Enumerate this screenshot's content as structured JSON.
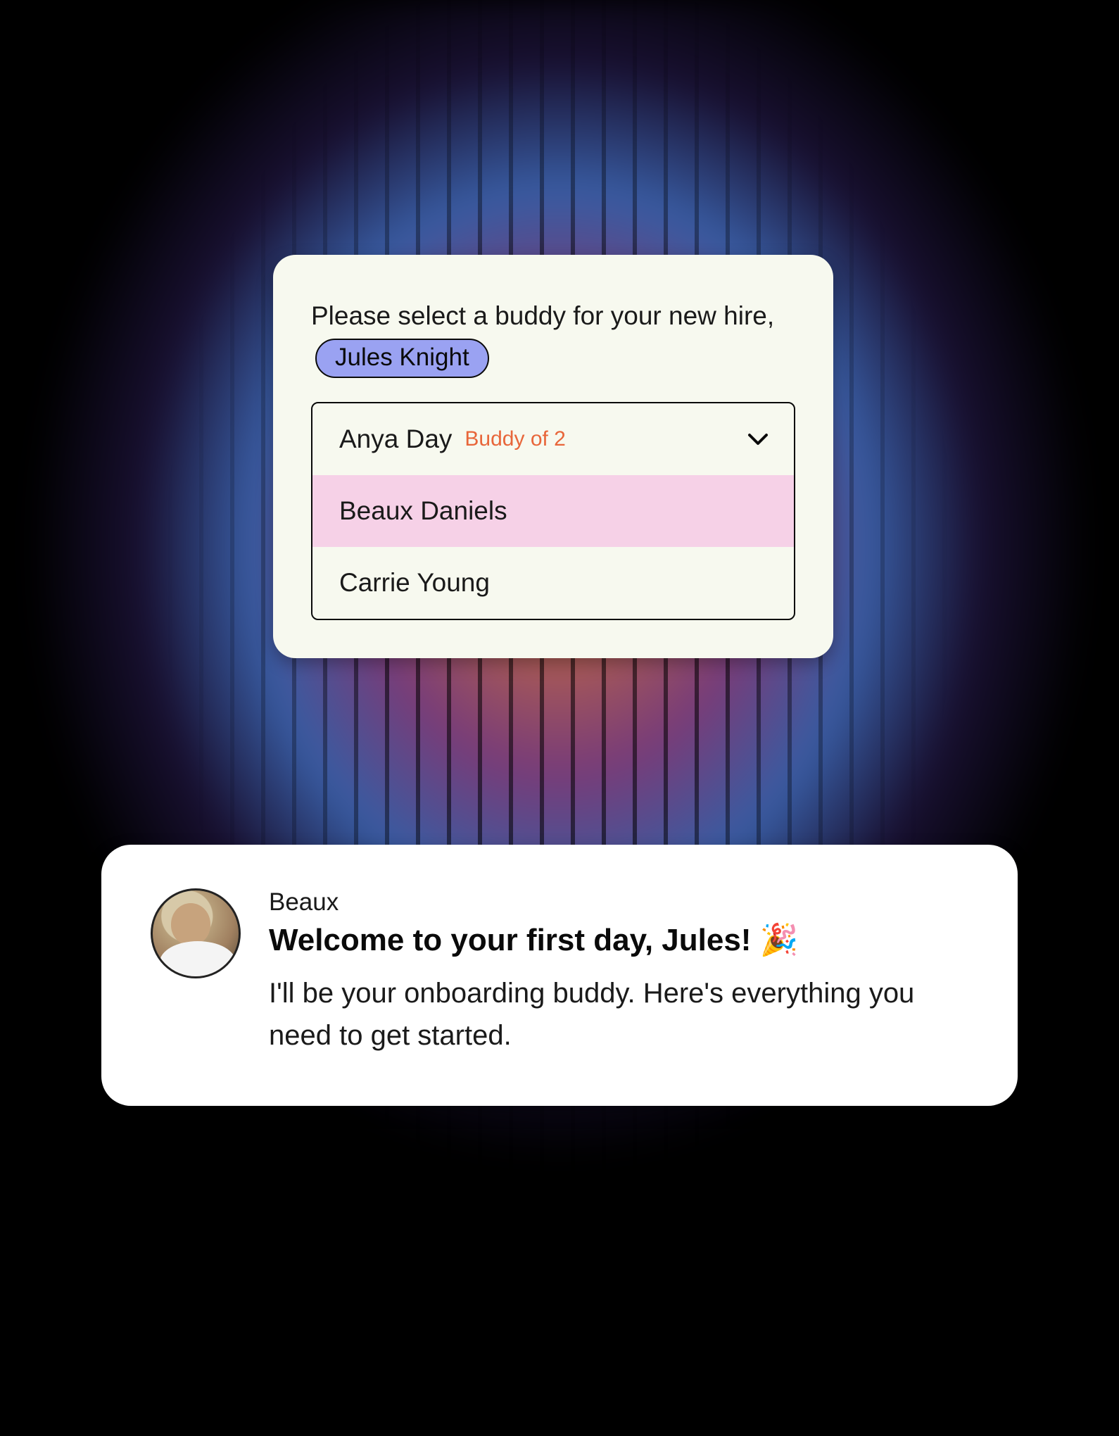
{
  "select_card": {
    "prompt_prefix": "Please select a buddy for your new hire, ",
    "new_hire_name": "Jules Knight",
    "options": [
      {
        "name": "Anya Day",
        "badge": "Buddy of 2",
        "highlighted": false
      },
      {
        "name": "Beaux Daniels",
        "badge": "",
        "highlighted": true
      },
      {
        "name": "Carrie Young",
        "badge": "",
        "highlighted": false
      }
    ]
  },
  "message": {
    "sender": "Beaux",
    "headline": "Welcome to your first day, Jules! 🎉",
    "body": "I'll be your onboarding buddy. Here's everything you need to get started."
  }
}
